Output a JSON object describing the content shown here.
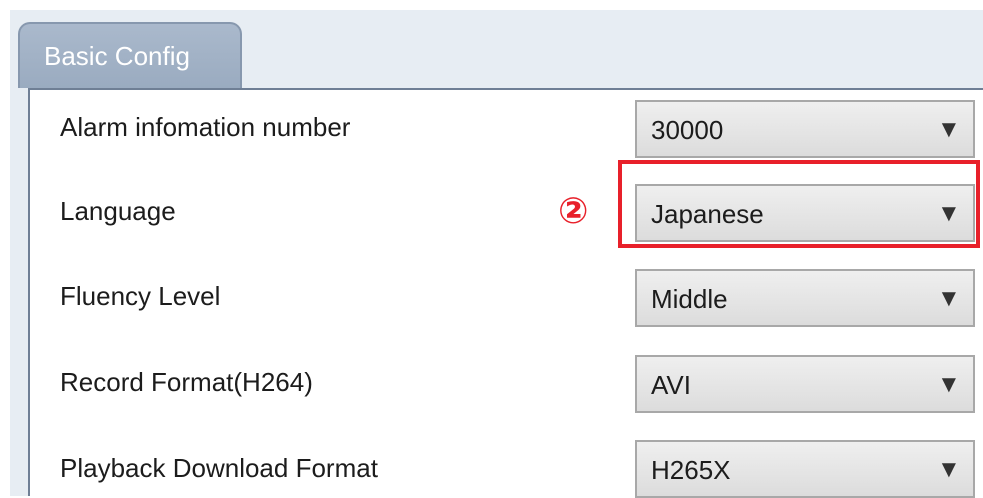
{
  "tab": {
    "label": "Basic Config"
  },
  "annotation": {
    "marker": "②",
    "color": "#e8202a"
  },
  "rows": [
    {
      "label": "Alarm infomation number",
      "value": "30000"
    },
    {
      "label": "Language",
      "value": "Japanese"
    },
    {
      "label": "Fluency Level",
      "value": "Middle"
    },
    {
      "label": "Record Format(H264)",
      "value": "AVI"
    },
    {
      "label": "Playback Download Format",
      "value": "H265X"
    }
  ],
  "icons": {
    "dropdown": "dropdown-triangle-icon",
    "arrow_glyph": "▼"
  }
}
